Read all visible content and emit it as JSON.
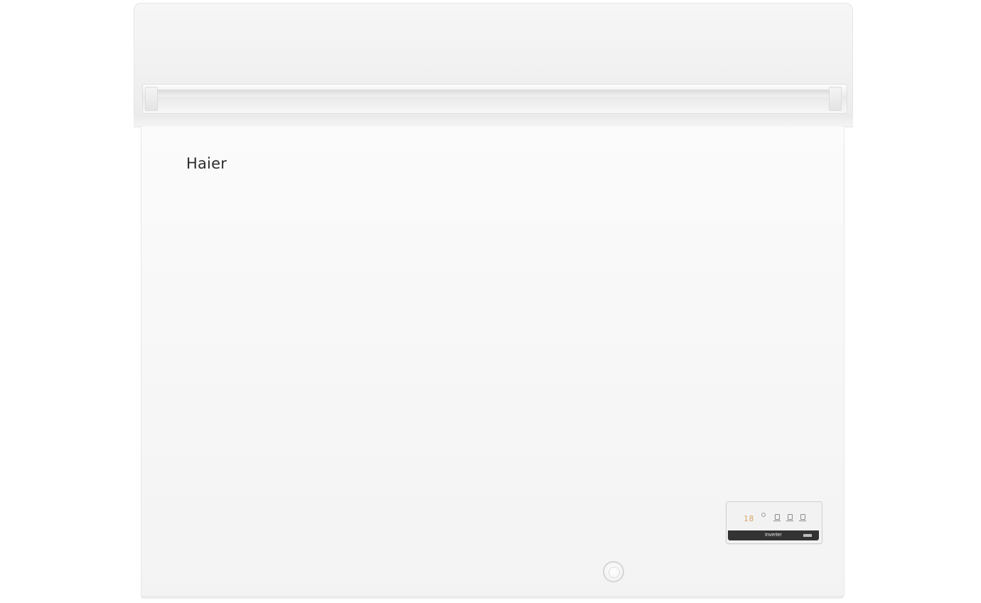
{
  "product": {
    "brand_text": "Haier",
    "body_color": "#f7f7f7",
    "lid_color": "#f2f2f2"
  },
  "control_panel": {
    "display_value": "18",
    "display_color": "#d9a46b",
    "strip_label": "Inverter",
    "strip_color": "#333333"
  },
  "icons": {
    "lock": "lock-icon",
    "panel_buttons": [
      "panel-button-icon",
      "panel-button-icon",
      "panel-button-icon"
    ]
  }
}
